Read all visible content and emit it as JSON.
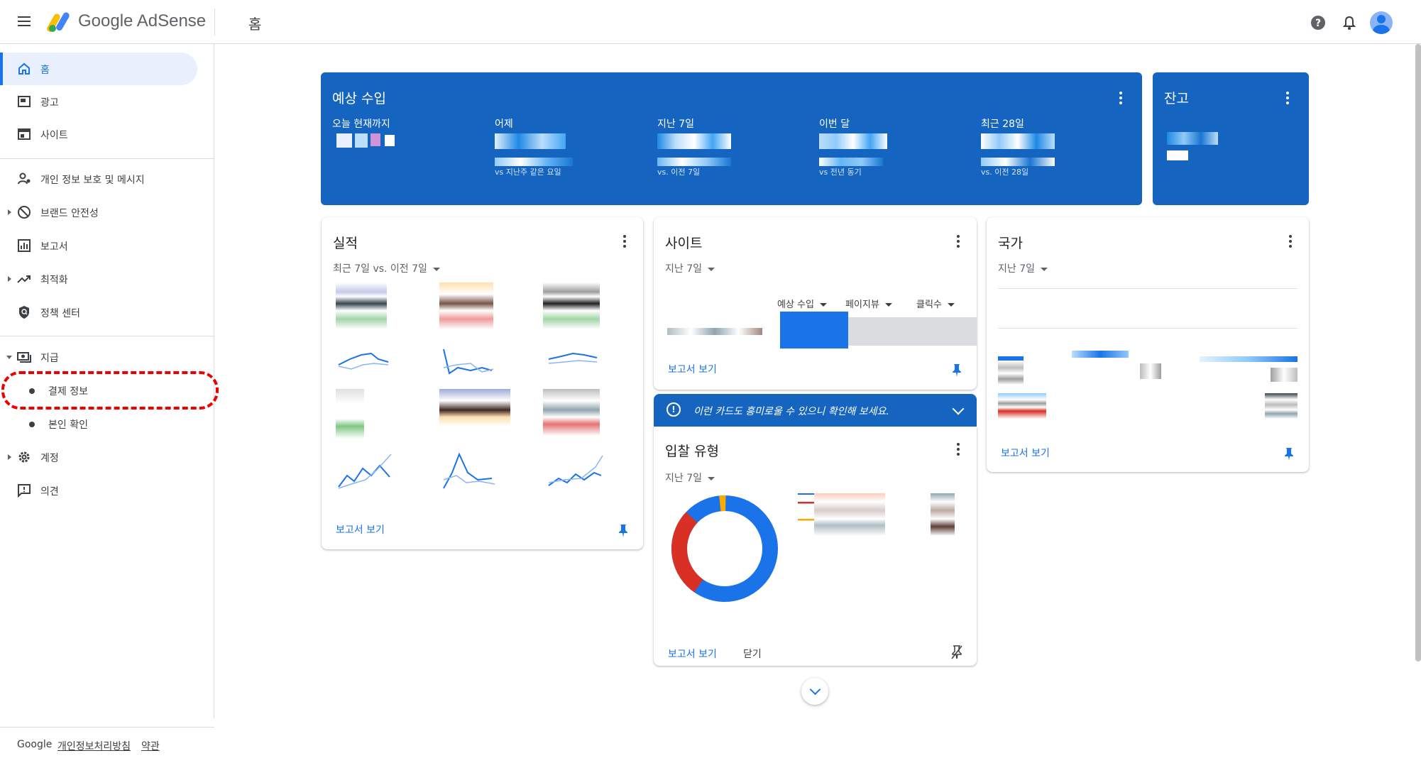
{
  "app": {
    "logo_text": "Google AdSense",
    "page_title": "홈"
  },
  "sidebar": {
    "items": [
      {
        "label": "홈",
        "icon": "home-icon",
        "active": true
      },
      {
        "label": "광고",
        "icon": "ads-icon"
      },
      {
        "label": "사이트",
        "icon": "sites-icon"
      },
      {
        "label": "개인 정보 보호 및 메시지",
        "icon": "privacy-icon"
      },
      {
        "label": "브랜드 안전성",
        "icon": "block-icon"
      },
      {
        "label": "보고서",
        "icon": "reports-icon"
      },
      {
        "label": "최적화",
        "icon": "trending-icon"
      },
      {
        "label": "정책 센터",
        "icon": "policy-shield-icon"
      },
      {
        "label": "지급",
        "icon": "payments-icon"
      },
      {
        "label": "결제 정보",
        "highlighted": true
      },
      {
        "label": "본인 확인"
      },
      {
        "label": "계정",
        "icon": "gear-icon"
      },
      {
        "label": "의견",
        "icon": "feedback-icon"
      }
    ],
    "footer": {
      "brand": "Google",
      "privacy": "개인정보처리방침",
      "terms": "약관"
    }
  },
  "earnings": {
    "title": "예상 수입",
    "metrics": [
      {
        "label": "오늘 현재까지",
        "compare": ""
      },
      {
        "label": "어제",
        "compare": "vs 지난주 같은 요일"
      },
      {
        "label": "지난 7일",
        "compare": "vs. 이전 7일"
      },
      {
        "label": "이번 달",
        "compare": "vs 전년 동기"
      },
      {
        "label": "최근 28일",
        "compare": "vs. 이전 28일"
      }
    ]
  },
  "balance": {
    "title": "잔고"
  },
  "performance": {
    "title": "실적",
    "range": "최근 7일 vs. 이전 7일",
    "link": "보고서 보기"
  },
  "sites": {
    "title": "사이트",
    "range": "지난 7일",
    "columns": [
      "예상 수입",
      "페이지뷰",
      "클릭수"
    ],
    "link": "보고서 보기"
  },
  "countries": {
    "title": "국가",
    "range": "지난 7일",
    "link": "보고서 보기"
  },
  "banner": {
    "text": "이런 카드도 흥미로울 수 있으니 확인해 보세요."
  },
  "bid_types": {
    "title": "입찰 유형",
    "range": "지난 7일",
    "link": "보고서 보기",
    "close": "닫기"
  },
  "colors": {
    "brand_blue": "#1565c0",
    "accent": "#1a73e8",
    "highlight": "#e00000"
  }
}
